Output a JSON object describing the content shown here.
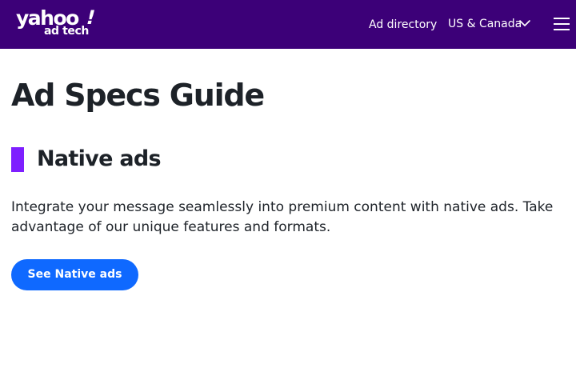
{
  "header": {
    "logo": {
      "word": "yahoo",
      "bang": "!",
      "sub": "ad tech"
    },
    "nav_link": "Ad directory",
    "region": {
      "label": "US & Canada",
      "icon": "chevron-down-icon"
    },
    "menu_icon": "hamburger-menu-icon",
    "background_color": "#3c0078"
  },
  "main": {
    "title": "Ad Specs Guide",
    "section": {
      "title": "Native ads",
      "accent_color": "#7e1fff",
      "description": "Integrate your message seamlessly into premium content with native ads. Take advantage of our unique features and formats.",
      "cta_label": "See Native ads",
      "cta_color": "#0f69ff"
    }
  }
}
